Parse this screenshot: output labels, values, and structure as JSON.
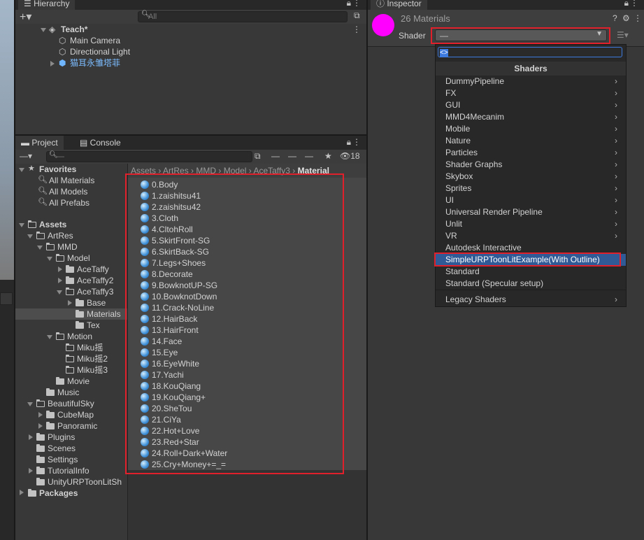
{
  "hierarchy": {
    "tab": "Hierarchy",
    "search_placeholder": "All",
    "scene": "Teach*",
    "items": [
      "Main Camera",
      "Directional Light",
      "猫耳永雏塔菲"
    ]
  },
  "project": {
    "tabs": [
      "Project",
      "Console"
    ],
    "search_value": "—",
    "hidden_count": "18",
    "favorites": {
      "label": "Favorites",
      "items": [
        "All Materials",
        "All Models",
        "All Prefabs"
      ]
    },
    "assets_label": "Assets",
    "tree": [
      "ArtRes",
      "MMD",
      "Model",
      "AceTaffy",
      "AceTaffy2",
      "AceTaffy3",
      "Base",
      "Materials",
      "Tex",
      "Motion",
      "Miku摇",
      "Miku摇2",
      "Miku摇3",
      "Movie",
      "Music",
      "BeautifulSky",
      "CubeMap",
      "Panoramic",
      "Plugins",
      "Scenes",
      "Settings",
      "TutorialInfo",
      "UnityURPToonLitSh"
    ],
    "packages_label": "Packages",
    "breadcrumb": [
      "Assets",
      "ArtRes",
      "MMD",
      "Model",
      "AceTaffy3",
      "Material"
    ],
    "materials": [
      "0.Body",
      "1.zaishitsu41",
      "2.zaishitsu42",
      "3.Cloth",
      "4.CltohRoll",
      "5.SkirtFront-SG",
      "6.SkirtBack-SG",
      "7.Legs+Shoes",
      "8.Decorate",
      "9.BowknotUP-SG",
      "10.BowknotDown",
      "11.Crack-NoLine",
      "12.HairBack",
      "13.HairFront",
      "14.Face",
      "15.Eye",
      "16.EyeWhite",
      "17.Yachi",
      "18.KouQiang",
      "19.KouQiang+",
      "20.SheTou",
      "21.CiYa",
      "22.Hot+Love",
      "23.Red+Star",
      "24.Roll+Dark+Water",
      "25.Cry+Money+=_="
    ]
  },
  "inspector": {
    "tab": "Inspector",
    "title": "26 Materials",
    "shader_label": "Shader",
    "shader_value": "—",
    "material_color": "#ff00ff",
    "dropdown": {
      "search_value": "<>",
      "header": "Shaders",
      "items": [
        {
          "label": "DummyPipeline",
          "sub": true
        },
        {
          "label": "FX",
          "sub": true
        },
        {
          "label": "GUI",
          "sub": true
        },
        {
          "label": "MMD4Mecanim",
          "sub": true
        },
        {
          "label": "Mobile",
          "sub": true
        },
        {
          "label": "Nature",
          "sub": true
        },
        {
          "label": "Particles",
          "sub": true
        },
        {
          "label": "Shader Graphs",
          "sub": true
        },
        {
          "label": "Skybox",
          "sub": true
        },
        {
          "label": "Sprites",
          "sub": true
        },
        {
          "label": "UI",
          "sub": true
        },
        {
          "label": "Universal Render Pipeline",
          "sub": true
        },
        {
          "label": "Unlit",
          "sub": true
        },
        {
          "label": "VR",
          "sub": true
        },
        {
          "label": "Autodesk Interactive",
          "sub": false
        },
        {
          "label": "SimpleURPToonLitExample(With Outline)",
          "sub": false,
          "selected": true
        },
        {
          "label": "Standard",
          "sub": false
        },
        {
          "label": "Standard (Specular setup)",
          "sub": false
        }
      ],
      "legacy": "Legacy Shaders"
    }
  },
  "colors": {
    "highlight": "#e0202a",
    "selected": "#2f5a96",
    "panel": "#383838"
  }
}
